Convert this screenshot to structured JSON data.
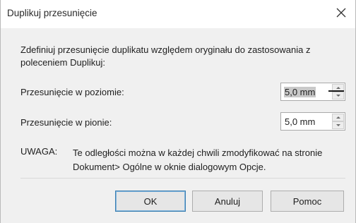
{
  "window": {
    "title": "Duplikuj przesunięcie",
    "close_label": "✕"
  },
  "description": "Zdefiniuj przesunięcie duplikatu względem oryginału do zastosowania z poleceniem Duplikuj:",
  "fields": {
    "horizontal": {
      "label": "Przesunięcie w poziomie:",
      "value": "5,0 mm"
    },
    "vertical": {
      "label": "Przesunięcie w pionie:",
      "value": "5,0 mm"
    }
  },
  "note": {
    "label": "UWAGA:",
    "text": "Te odległości można w każdej chwili zmodyfikować na stronie Dokument> Ogólne w oknie dialogowym Opcje."
  },
  "buttons": {
    "ok": "OK",
    "cancel": "Anuluj",
    "help": "Pomoc"
  }
}
